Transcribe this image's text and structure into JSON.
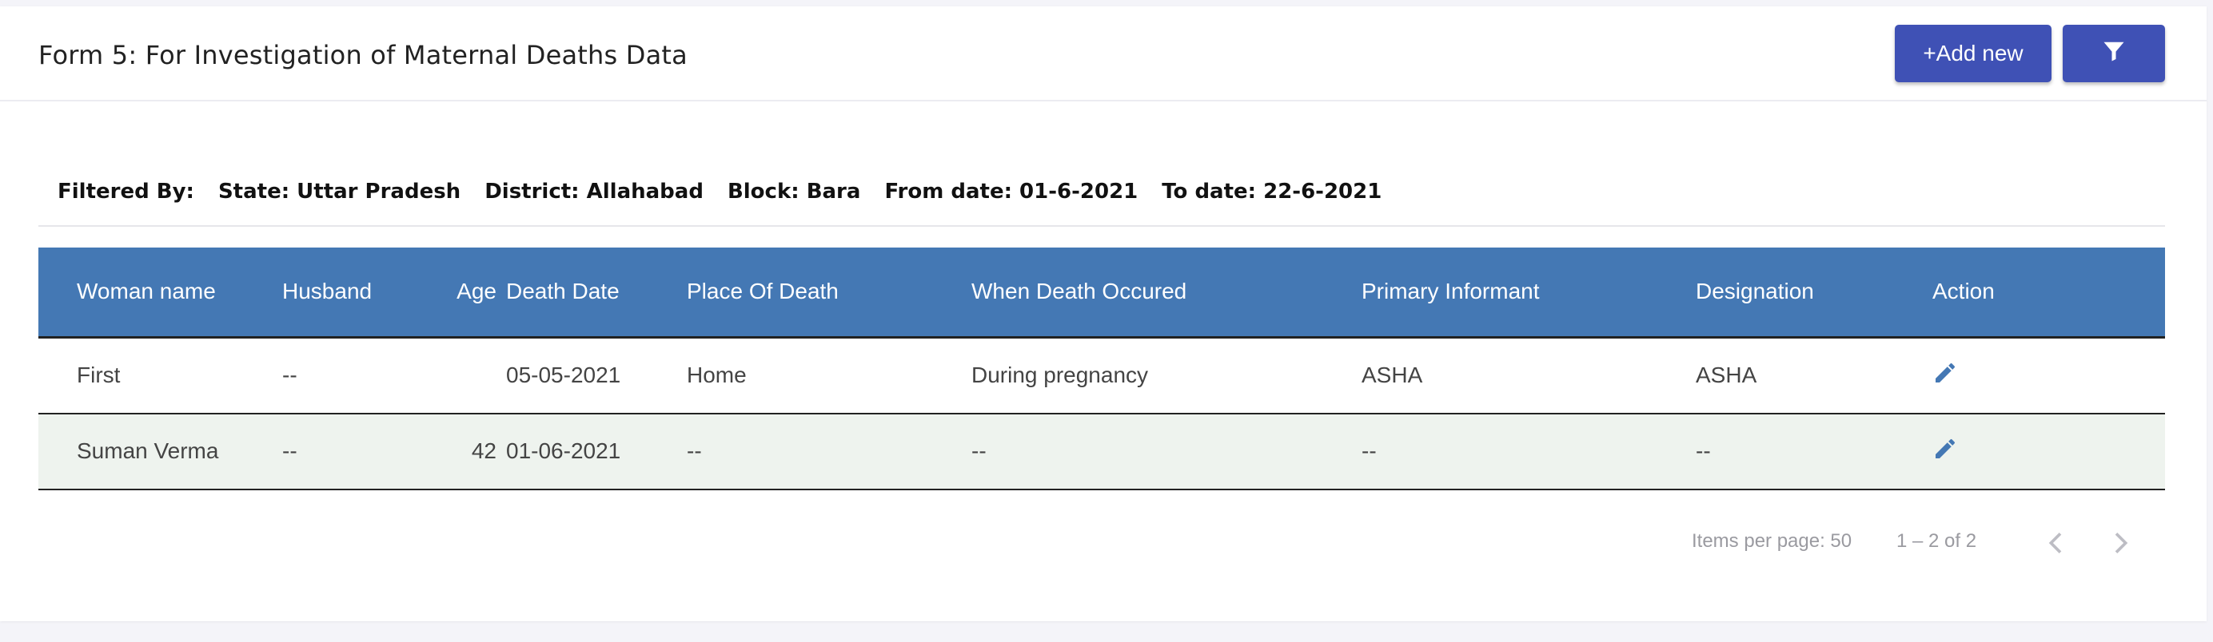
{
  "header": {
    "title": "Form 5: For Investigation of Maternal Deaths Data",
    "add_label": "+Add new"
  },
  "filters": {
    "label": "Filtered By:",
    "state": "State: Uttar Pradesh",
    "district": "District: Allahabad",
    "block": "Block: Bara",
    "from_date": "From date: 01-6-2021",
    "to_date": "To date: 22-6-2021"
  },
  "table": {
    "columns": [
      "Woman name",
      "Husband",
      "Age",
      "Death Date",
      "Place Of Death",
      "When Death Occured",
      "Primary Informant",
      "Designation",
      "Action"
    ],
    "rows": [
      [
        "First",
        "--",
        "",
        "05-05-2021",
        "Home",
        "During pregnancy",
        "ASHA",
        "ASHA"
      ],
      [
        "Suman Verma",
        "--",
        "42",
        "01-06-2021",
        "--",
        "--",
        "--",
        "--"
      ]
    ]
  },
  "paginator": {
    "items_per_page": "Items per page: 50",
    "range": "1 – 2 of 2"
  },
  "colors": {
    "primary_button": "#3f51b5",
    "table_header": "#4478b4",
    "alt_row": "#eef3ee"
  },
  "icons": {
    "filter": "filter-icon",
    "edit": "pencil-icon",
    "prev": "chevron-left-icon",
    "next": "chevron-right-icon"
  }
}
